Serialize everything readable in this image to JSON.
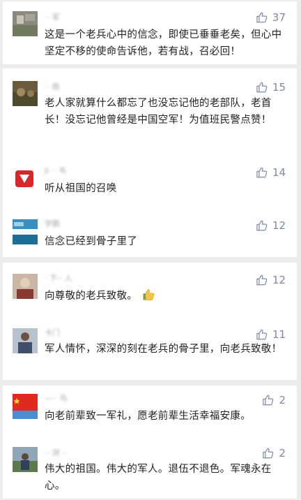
{
  "comments": [
    {
      "name": "·· 军",
      "likes": "37",
      "text": "这是一个老兵心中的信念，即使已垂垂老矣，但心中坚定不移的使命告诉他，若有战，召必回！"
    },
    {
      "name": "·· 雨",
      "likes": "15",
      "text": "老人家就算什么都忘了也没忘记他的老部队，老首长！没忘记他曾经是中国空军！为值班民警点赞！"
    },
    {
      "name": "Ji ·· 韦",
      "likes": "14",
      "text": "听从祖国的召唤"
    },
    {
      "name": "学鹏",
      "likes": "12",
      "text": "信念已经到骨子里了"
    },
    {
      "name": "· 下·· 人",
      "likes": "12",
      "text": "向尊敬的老兵致敬。"
    },
    {
      "name": "卡门",
      "likes": "11",
      "text": "军人情怀，深深的刻在老兵的骨子里，向老兵致敬！"
    },
    {
      "name": "—·· 鸟",
      "likes": "2",
      "text": "向老前辈致一军礼，愿老前辈生活幸福安康。"
    },
    {
      "name": "·· 测 ··",
      "likes": "2",
      "text": "伟大的祖国。伟大的军人。退伍不退色。军魂永在心。"
    }
  ],
  "icons": {
    "like": "thumbs-up-outline-icon",
    "emoji": "thumbs-up-emoji"
  },
  "colors": {
    "like": "#7c8aa3",
    "text": "#222222",
    "background": "#ececec"
  }
}
